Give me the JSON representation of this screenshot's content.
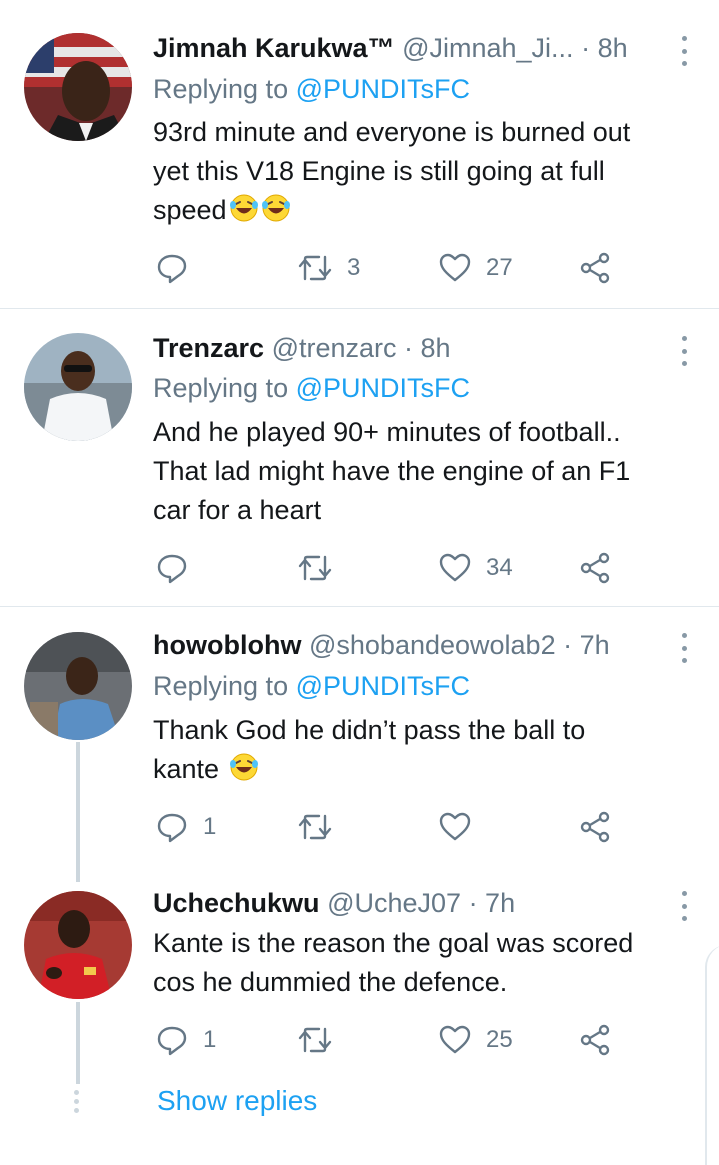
{
  "replies": [
    {
      "name": "Jimnah Karukwa™",
      "handle": "@Jimnah_Ji...",
      "time": "· 8h",
      "replying_prefix": "Replying to",
      "replying_to": "@PUNDITsFC",
      "text_lines": [
        "93rd minute and everyone is burned out",
        "yet this V18 Engine is still going at full",
        "speed"
      ],
      "retweets": "3",
      "likes": "27"
    },
    {
      "name": "Trenzarc",
      "handle": "@trenzarc",
      "time": "· 8h",
      "replying_prefix": "Replying to",
      "replying_to": "@PUNDITsFC",
      "text_lines": [
        "And he played 90+ minutes of football..",
        "That lad might have the engine of an F1",
        "car for a heart"
      ],
      "retweets": "",
      "likes": "34"
    },
    {
      "name": "howoblohw",
      "handle": "@shobandeowolab2",
      "time": "· 7h",
      "replying_prefix": "Replying to",
      "replying_to": "@PUNDITsFC",
      "text_lines": [
        "Thank God he didn’t pass the ball to",
        "kante"
      ],
      "replies": "1",
      "retweets": "",
      "likes": ""
    },
    {
      "name": "Uchechukwu",
      "handle": "@UcheJ07",
      "time": "· 7h",
      "text_lines": [
        "Kante is the reason the goal was scored",
        "cos he dummied the defence."
      ],
      "replies": "1",
      "retweets": "",
      "likes": "25"
    }
  ],
  "show_replies": "Show replies",
  "icons": [
    "reply-icon",
    "retweet-icon",
    "like-icon",
    "share-icon",
    "more-icon",
    "laughing-emoji"
  ],
  "colors": {
    "link": "#1da1f2",
    "secondary": "#657786",
    "divider": "#e1e8ed",
    "thread": "#ccd6dd"
  }
}
